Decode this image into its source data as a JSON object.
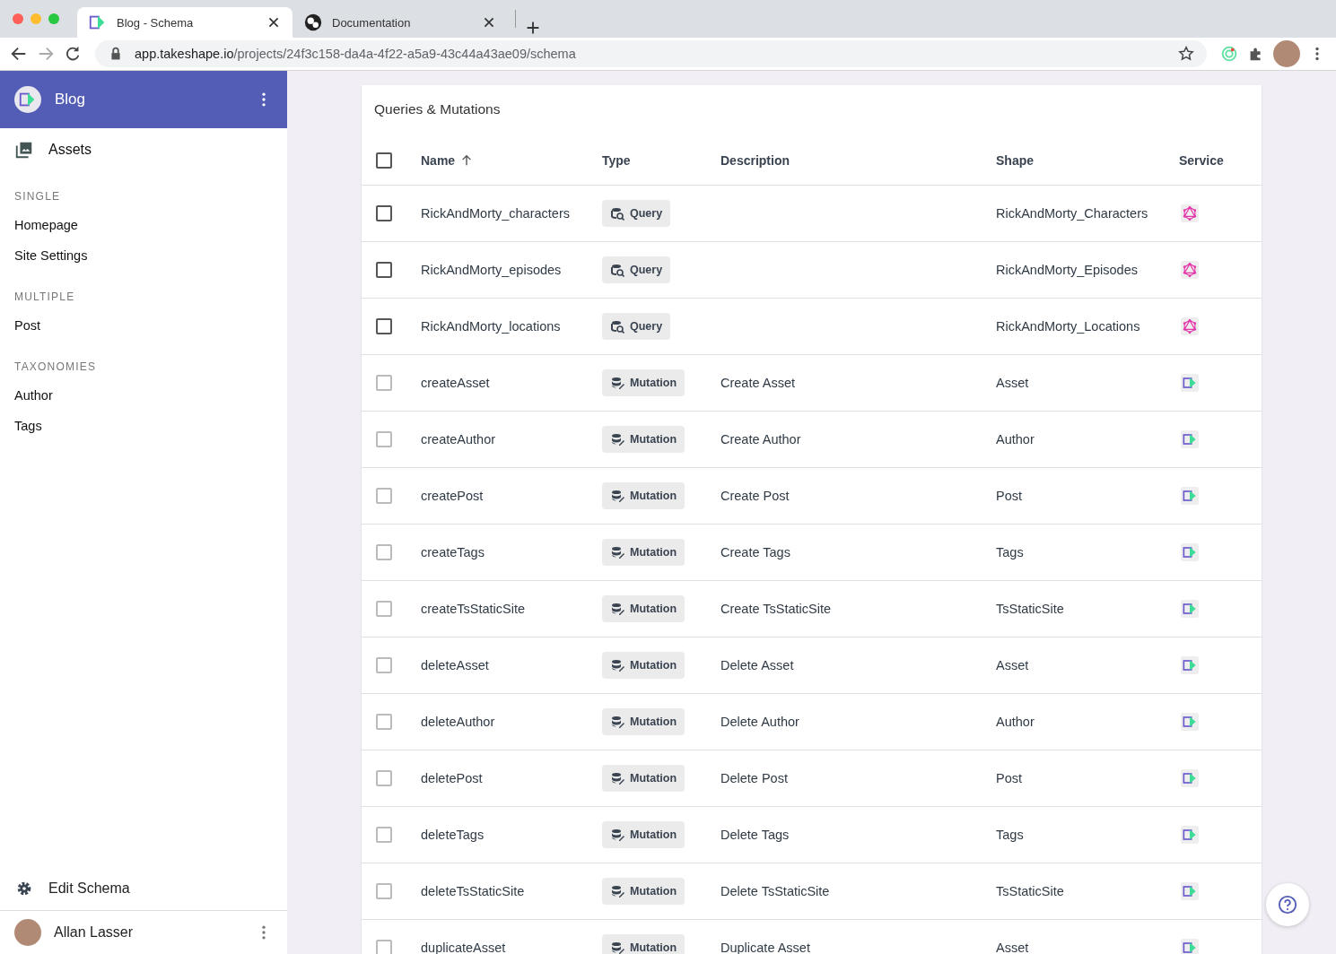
{
  "browser": {
    "tabs": [
      {
        "title": "Blog - Schema",
        "favicon": {
          "kind": "takeshape"
        },
        "selected": true
      },
      {
        "title": "Documentation",
        "favicon": {
          "kind": "globe"
        },
        "selected": false
      }
    ],
    "url": {
      "host": "app.takeshape.io",
      "path": "/projects/24f3c158-da4a-4f22-a5a9-43c44a43ae09/schema"
    }
  },
  "sidebar": {
    "project": "Blog",
    "assets": "Assets",
    "sections": [
      {
        "title": "SINGLE",
        "items": [
          "Homepage",
          "Site Settings"
        ]
      },
      {
        "title": "MULTIPLE",
        "items": [
          "Post"
        ]
      },
      {
        "title": "TAXONOMIES",
        "items": [
          "Author",
          "Tags"
        ]
      }
    ],
    "edit_schema": "Edit Schema",
    "user": "Allan Lasser"
  },
  "table": {
    "title": "Queries & Mutations",
    "select_all": {
      "checked": false
    },
    "columns": [
      {
        "label": "Name",
        "sorted": true
      },
      {
        "label": "Type",
        "sorted": false
      },
      {
        "label": "Description",
        "sorted": false
      },
      {
        "label": "Shape",
        "sorted": false
      },
      {
        "label": "Service",
        "sorted": false
      }
    ],
    "rows": [
      {
        "name": "RickAndMorty_characters",
        "kind": "query",
        "type": "Query",
        "shape": "RickAndMorty_Characters",
        "service": {
          "kind": "graphql"
        },
        "checked": false,
        "disabled": false
      },
      {
        "name": "RickAndMorty_episodes",
        "kind": "query",
        "type": "Query",
        "shape": "RickAndMorty_Episodes",
        "service": {
          "kind": "graphql"
        },
        "checked": false,
        "disabled": false
      },
      {
        "name": "RickAndMorty_locations",
        "kind": "query",
        "type": "Query",
        "shape": "RickAndMorty_Locations",
        "service": {
          "kind": "graphql"
        },
        "checked": false,
        "disabled": false
      },
      {
        "name": "createAsset",
        "kind": "mutation",
        "type": "Mutation",
        "description": "Create Asset",
        "shape": "Asset",
        "service": {
          "kind": "takeshape"
        },
        "checked": false,
        "disabled": true
      },
      {
        "name": "createAuthor",
        "kind": "mutation",
        "type": "Mutation",
        "description": "Create Author",
        "shape": "Author",
        "service": {
          "kind": "takeshape"
        },
        "checked": false,
        "disabled": true
      },
      {
        "name": "createPost",
        "kind": "mutation",
        "type": "Mutation",
        "description": "Create Post",
        "shape": "Post",
        "service": {
          "kind": "takeshape"
        },
        "checked": false,
        "disabled": true
      },
      {
        "name": "createTags",
        "kind": "mutation",
        "type": "Mutation",
        "description": "Create Tags",
        "shape": "Tags",
        "service": {
          "kind": "takeshape"
        },
        "checked": false,
        "disabled": true
      },
      {
        "name": "createTsStaticSite",
        "kind": "mutation",
        "type": "Mutation",
        "description": "Create TsStaticSite",
        "shape": "TsStaticSite",
        "service": {
          "kind": "takeshape"
        },
        "checked": false,
        "disabled": true
      },
      {
        "name": "deleteAsset",
        "kind": "mutation",
        "type": "Mutation",
        "description": "Delete Asset",
        "shape": "Asset",
        "service": {
          "kind": "takeshape"
        },
        "checked": false,
        "disabled": true
      },
      {
        "name": "deleteAuthor",
        "kind": "mutation",
        "type": "Mutation",
        "description": "Delete Author",
        "shape": "Author",
        "service": {
          "kind": "takeshape"
        },
        "checked": false,
        "disabled": true
      },
      {
        "name": "deletePost",
        "kind": "mutation",
        "type": "Mutation",
        "description": "Delete Post",
        "shape": "Post",
        "service": {
          "kind": "takeshape"
        },
        "checked": false,
        "disabled": true
      },
      {
        "name": "deleteTags",
        "kind": "mutation",
        "type": "Mutation",
        "description": "Delete Tags",
        "shape": "Tags",
        "service": {
          "kind": "takeshape"
        },
        "checked": false,
        "disabled": true
      },
      {
        "name": "deleteTsStaticSite",
        "kind": "mutation",
        "type": "Mutation",
        "description": "Delete TsStaticSite",
        "shape": "TsStaticSite",
        "service": {
          "kind": "takeshape"
        },
        "checked": false,
        "disabled": true
      },
      {
        "name": "duplicateAsset",
        "kind": "mutation",
        "type": "Mutation",
        "description": "Duplicate Asset",
        "shape": "Asset",
        "service": {
          "kind": "takeshape"
        },
        "checked": false,
        "disabled": true
      }
    ]
  }
}
